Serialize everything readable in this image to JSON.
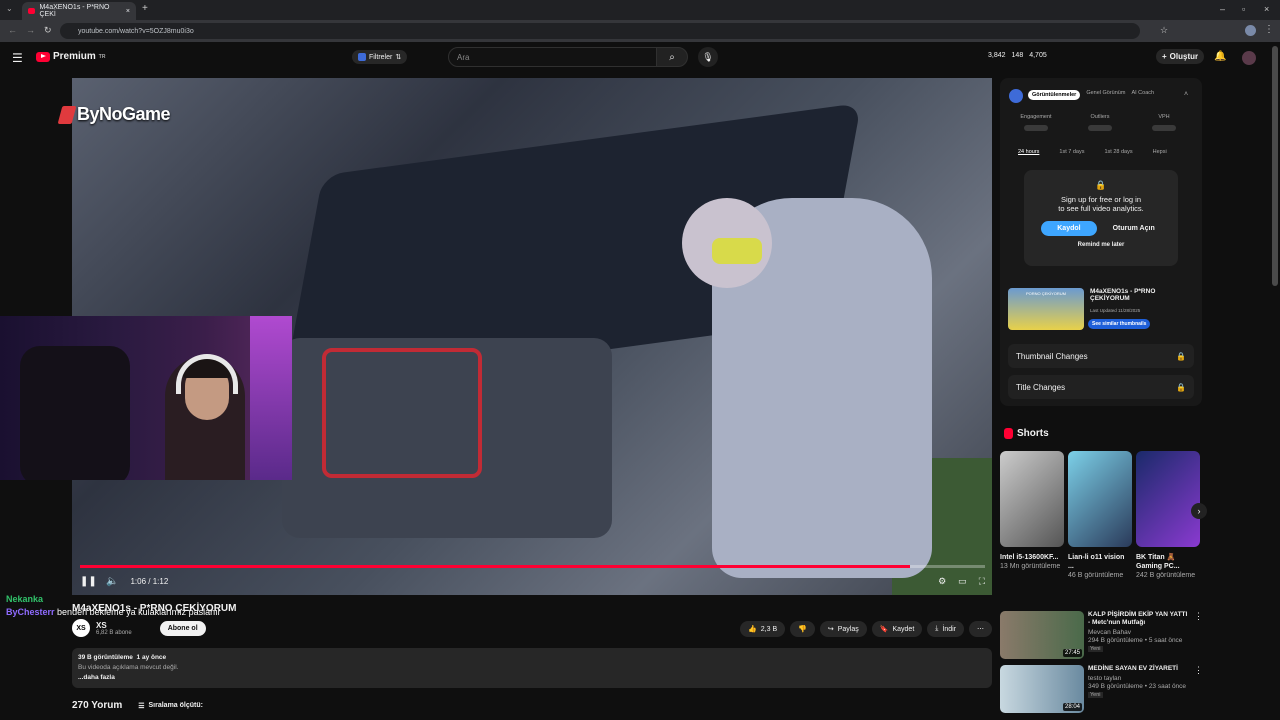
{
  "browser": {
    "tab_title": "M4aXENO1s - P*RNO ÇEKİ",
    "url": "youtube.com/watch?v=5OZJ8mu0i3o"
  },
  "header": {
    "logo_text": "Premium",
    "logo_sup": "TR",
    "filters_label": "Filtreler",
    "search_placeholder": "Ara",
    "stat1": "3,842",
    "stat2": "148",
    "stat3": "4,705",
    "create_label": "Oluştur"
  },
  "player": {
    "watermark": "ByNoGame",
    "time": "1:06 / 1:12",
    "progress": 0.917
  },
  "chat": [
    {
      "user": "Nekanka",
      "msg": "",
      "color": "#31c26a"
    },
    {
      "user": "ByChesterr",
      "msg": "benden bekleme ya kulaklarımız paslanır",
      "color": "#8f6bff"
    }
  ],
  "video": {
    "title": "M4aXENO1s - P*RNO ÇEKİYORUM",
    "channel_initials": "XS",
    "channel_name": "XS",
    "subs": "6,82 B abone",
    "subscribe": "Abone ol",
    "likes": "2,3 B",
    "share": "Paylaş",
    "save": "Kaydet",
    "download": "İndir",
    "views": "39 B görüntüleme",
    "age": "1 ay önce",
    "desc": "Bu videoda açıklama mevcut değil.",
    "more": "...daha fazla",
    "comments": "270 Yorum",
    "sort": "Sıralama ölçütü:"
  },
  "analytics": {
    "tabs": [
      "Görüntülenmeler",
      "Genel Görünüm",
      "AI Coach"
    ],
    "metrics": [
      "Engagement",
      "Outliers",
      "VPH"
    ],
    "ranges": [
      "24 hours",
      "1st 7 days",
      "1st 28 days",
      "Hepsi"
    ],
    "modal_line1": "Sign up for free or log in",
    "modal_line2": "to see full video analytics.",
    "signup": "Kaydol",
    "login": "Oturum Açın",
    "remind": "Remind me later",
    "card_title": "M4aXENO1s - P*RNO ÇEKİYORUM",
    "card_thumb_text": "PORNO ÇEKİYORUM",
    "card_updated": "Last Updated 11/28/2025",
    "card_btn": "See similar thumbnails",
    "thumb_changes": "Thumbnail Changes",
    "title_changes": "Title Changes"
  },
  "shorts": {
    "heading": "Shorts",
    "items": [
      {
        "title": "Intel i5-13600KF...",
        "views": "13 Mn görüntüleme"
      },
      {
        "title": "Lian-li o11 vision ...",
        "views": "46 B görüntüleme"
      },
      {
        "title": "BK Titan 🧸 Gaming PC...",
        "views": "242 B görüntüleme"
      }
    ]
  },
  "recs": [
    {
      "title": "KALP PİŞİRDİM EKİP YAN YATTI - Metc'nun Mutfağı",
      "channel": "Mevcan Bahav",
      "meta": "294 B görüntüleme • 5 saat önce",
      "badge": "Yeni",
      "dur": "27:45"
    },
    {
      "title": "MEDİNE SAYAN EV ZİYARETİ",
      "channel": "testo taylan",
      "meta": "349 B görüntüleme • 23 saat önce",
      "badge": "Yeni",
      "dur": "28:04"
    }
  ],
  "colors": {
    "accent": "#ff0033",
    "blue": "#3ea6ff"
  }
}
